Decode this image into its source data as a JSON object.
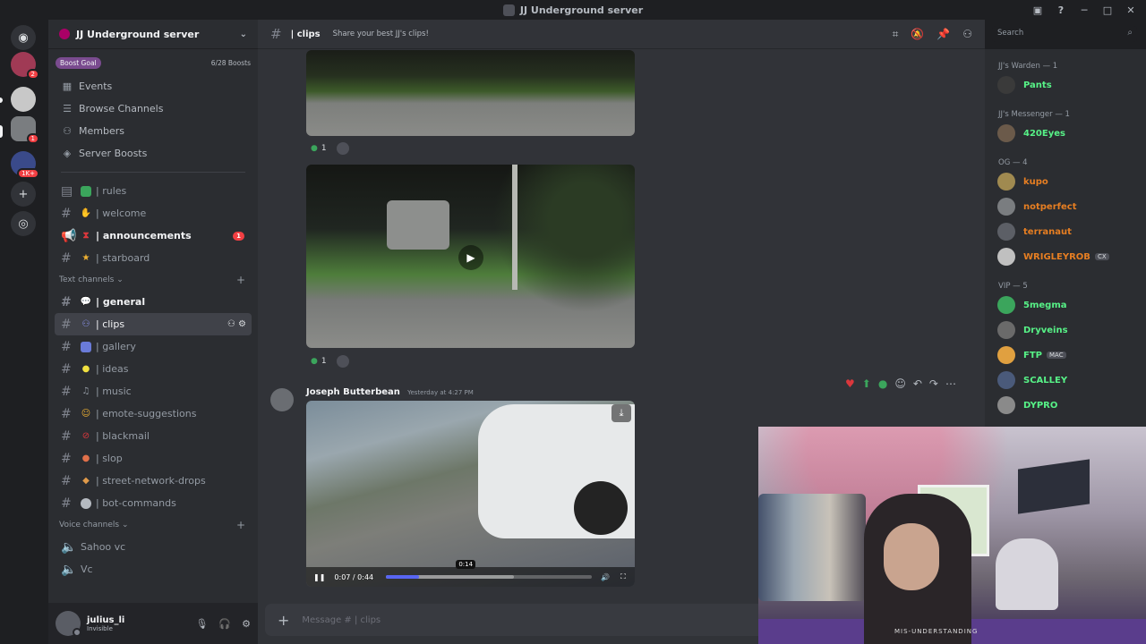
{
  "window": {
    "title": "JJ Underground server"
  },
  "guilds": [
    {
      "name": "direct-messages",
      "badge": ""
    },
    {
      "name": "guild-2",
      "badge": "2"
    },
    {
      "name": "guild-3",
      "badge": ""
    },
    {
      "name": "guild-4",
      "badge": "1"
    },
    {
      "name": "guild-5",
      "badge": "1K+"
    }
  ],
  "server": {
    "name": "JJ Underground server",
    "boost_label": "Boost Goal",
    "boost_count": "6/28 Boosts",
    "nav": [
      {
        "label": "Events",
        "icon": "calendar-icon"
      },
      {
        "label": "Browse Channels",
        "icon": "browse-icon"
      },
      {
        "label": "Members",
        "icon": "members-icon"
      },
      {
        "label": "Server Boosts",
        "icon": "boost-icon"
      }
    ],
    "top_channels": [
      {
        "label": "| rules",
        "emoji_color": "#3ba55c",
        "bold": false,
        "badge": ""
      },
      {
        "label": "| welcome",
        "emoji_color": "#f0b232",
        "bold": false,
        "badge": ""
      },
      {
        "label": "| announcements",
        "emoji_color": "#da373c",
        "bold": true,
        "badge": "1"
      },
      {
        "label": "| starboard",
        "emoji_color": "#f0b232",
        "bold": false,
        "badge": ""
      }
    ],
    "text_category": "Text channels",
    "text_channels": [
      {
        "label": "| general",
        "emoji_color": "#dbdee1",
        "bold": true,
        "active": false
      },
      {
        "label": "| clips",
        "emoji_color": "#5865f2",
        "bold": false,
        "active": true
      },
      {
        "label": "| gallery",
        "emoji_color": "#6a7bd8",
        "bold": false,
        "active": false
      },
      {
        "label": "| ideas",
        "emoji_color": "#f0e040",
        "bold": false,
        "active": false
      },
      {
        "label": "| music",
        "emoji_color": "#80848e",
        "bold": false,
        "active": false
      },
      {
        "label": "| emote-suggestions",
        "emoji_color": "#f0b232",
        "bold": false,
        "active": false
      },
      {
        "label": "| blackmail",
        "emoji_color": "#da373c",
        "bold": false,
        "active": false
      },
      {
        "label": "| slop",
        "emoji_color": "#e0704a",
        "bold": false,
        "active": false
      },
      {
        "label": "| street-network-drops",
        "emoji_color": "#e09a4a",
        "bold": false,
        "active": false
      },
      {
        "label": "| bot-commands",
        "emoji_color": "#b5bac1",
        "bold": false,
        "active": false
      }
    ],
    "voice_category": "Voice channels",
    "voice_channels": [
      {
        "label": "Sahoo vc"
      },
      {
        "label": "Vc"
      }
    ]
  },
  "user": {
    "name": "julius_li",
    "status": "Invisible"
  },
  "channel": {
    "name": "| clips",
    "topic": "Share your best JJ's clips!",
    "search_placeholder": "Search"
  },
  "messages": {
    "reaction_count_1": "1",
    "reaction_count_2": "1",
    "author": "Joseph Butterbean",
    "timestamp": "Yesterday at 4:27 PM",
    "video_time": "0:07 / 0:44",
    "hover_time": "0:14",
    "progress_fraction": 0.16,
    "buffered_fraction": 0.62
  },
  "composer": {
    "placeholder": "Message #  | clips"
  },
  "members": {
    "groups": [
      {
        "role": "JJ's Warden — 1",
        "people": [
          {
            "name": "Pants",
            "color": "#57f287",
            "tag": ""
          }
        ]
      },
      {
        "role": "JJ's Messenger — 1",
        "people": [
          {
            "name": "420Eyes",
            "color": "#57f287",
            "tag": ""
          }
        ]
      },
      {
        "role": "OG — 4",
        "people": [
          {
            "name": "kupo",
            "color": "#e67e22",
            "tag": ""
          },
          {
            "name": "notperfect",
            "color": "#e67e22",
            "tag": ""
          },
          {
            "name": "terranaut",
            "color": "#e67e22",
            "tag": ""
          },
          {
            "name": "WRIGLEYROB",
            "color": "#e67e22",
            "tag": "CX"
          }
        ]
      },
      {
        "role": "VIP — 5",
        "people": [
          {
            "name": "5megma",
            "color": "#57f287",
            "tag": ""
          },
          {
            "name": "Dryveins",
            "color": "#57f287",
            "tag": ""
          },
          {
            "name": "FTP",
            "color": "#57f287",
            "tag": "MAC"
          },
          {
            "name": "SCALLEY",
            "color": "#57f287",
            "tag": ""
          },
          {
            "name": "DYPRO",
            "color": "#57f287",
            "tag": ""
          }
        ]
      }
    ]
  },
  "webcam": {
    "shirt_text": "MIS-UNDERSTANDING"
  }
}
